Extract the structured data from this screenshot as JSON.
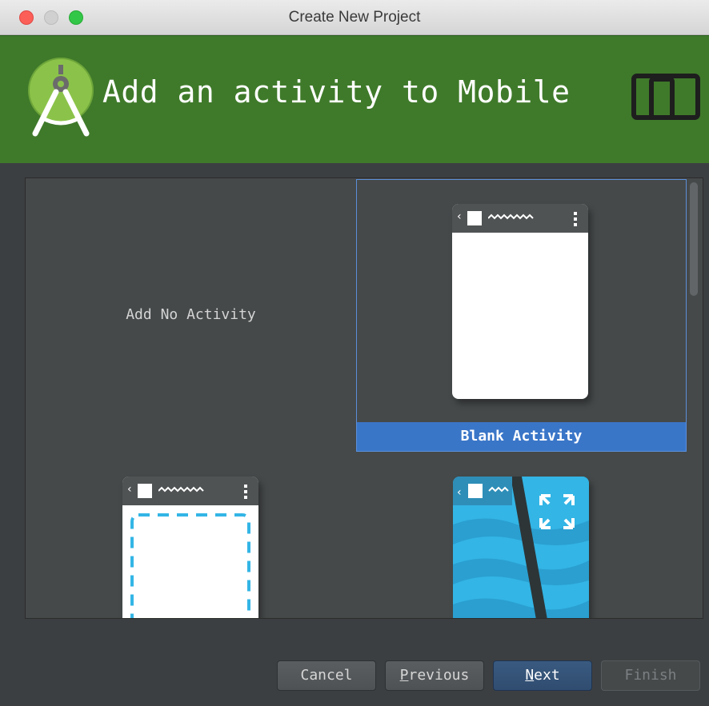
{
  "window": {
    "title": "Create New Project"
  },
  "header": {
    "title": "Add an activity to Mobile",
    "accent_color": "#3f7a2a",
    "logo_icon": "android-studio-logo-icon",
    "device_icon": "phone-tablet-icon"
  },
  "gallery": {
    "tiles": [
      {
        "label": "Add No Activity",
        "selected": false
      },
      {
        "label": "Blank Activity",
        "selected": true
      },
      {
        "label": "",
        "selected": false
      },
      {
        "label": "",
        "selected": false
      }
    ],
    "selection_color": "#3a76c8"
  },
  "footer": {
    "cancel_label": "Cancel",
    "previous_mnemonic": "P",
    "previous_rest": "revious",
    "next_mnemonic": "N",
    "next_rest": "ext",
    "finish_label": "Finish"
  }
}
